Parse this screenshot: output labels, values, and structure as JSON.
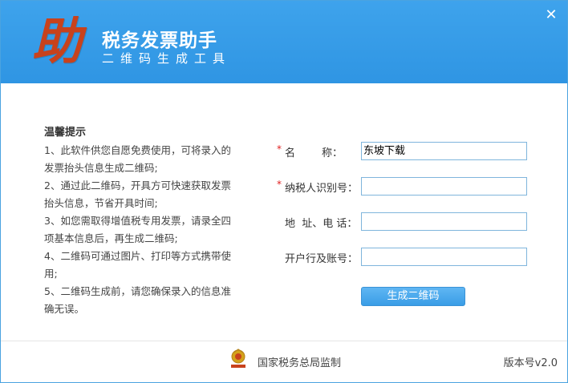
{
  "header": {
    "logo_char": "助",
    "title": "税务发票助手",
    "subtitle": "二维码生成工具",
    "close_symbol": "✕"
  },
  "tips": {
    "title": "温馨提示",
    "items": [
      "1、此软件供您自愿免费使用，可将录入的发票抬头信息生成二维码;",
      "2、通过此二维码，开具方可快速获取发票抬头信息，节省开具时间;",
      "3、如您需取得增值税专用发票，请录全四项基本信息后，再生成二维码;",
      "4、二维码可通过图片、打印等方式携带使用;",
      "5、二维码生成前，请您确保录入的信息准确无误。"
    ]
  },
  "form": {
    "fields": [
      {
        "required": true,
        "label": "名        称：",
        "value": ""
      },
      {
        "required": true,
        "label": "纳税人识别号：",
        "value": ""
      },
      {
        "required": false,
        "label": "地  址、电 话：",
        "value": ""
      },
      {
        "required": false,
        "label": "开户行及账号：",
        "value": ""
      }
    ],
    "name_value": "东坡下载",
    "required_mark": "*",
    "generate_label": "生成二维码"
  },
  "footer": {
    "supervise_text": "国家税务总局监制",
    "version_text": "版本号v2.0",
    "emblem_text": "中国税务"
  },
  "colors": {
    "header": "#3ea3ec",
    "logo": "#c8421c",
    "button": "#3a9de6",
    "required": "#e02020"
  },
  "icons": [
    "close-icon",
    "tax-emblem-icon"
  ]
}
